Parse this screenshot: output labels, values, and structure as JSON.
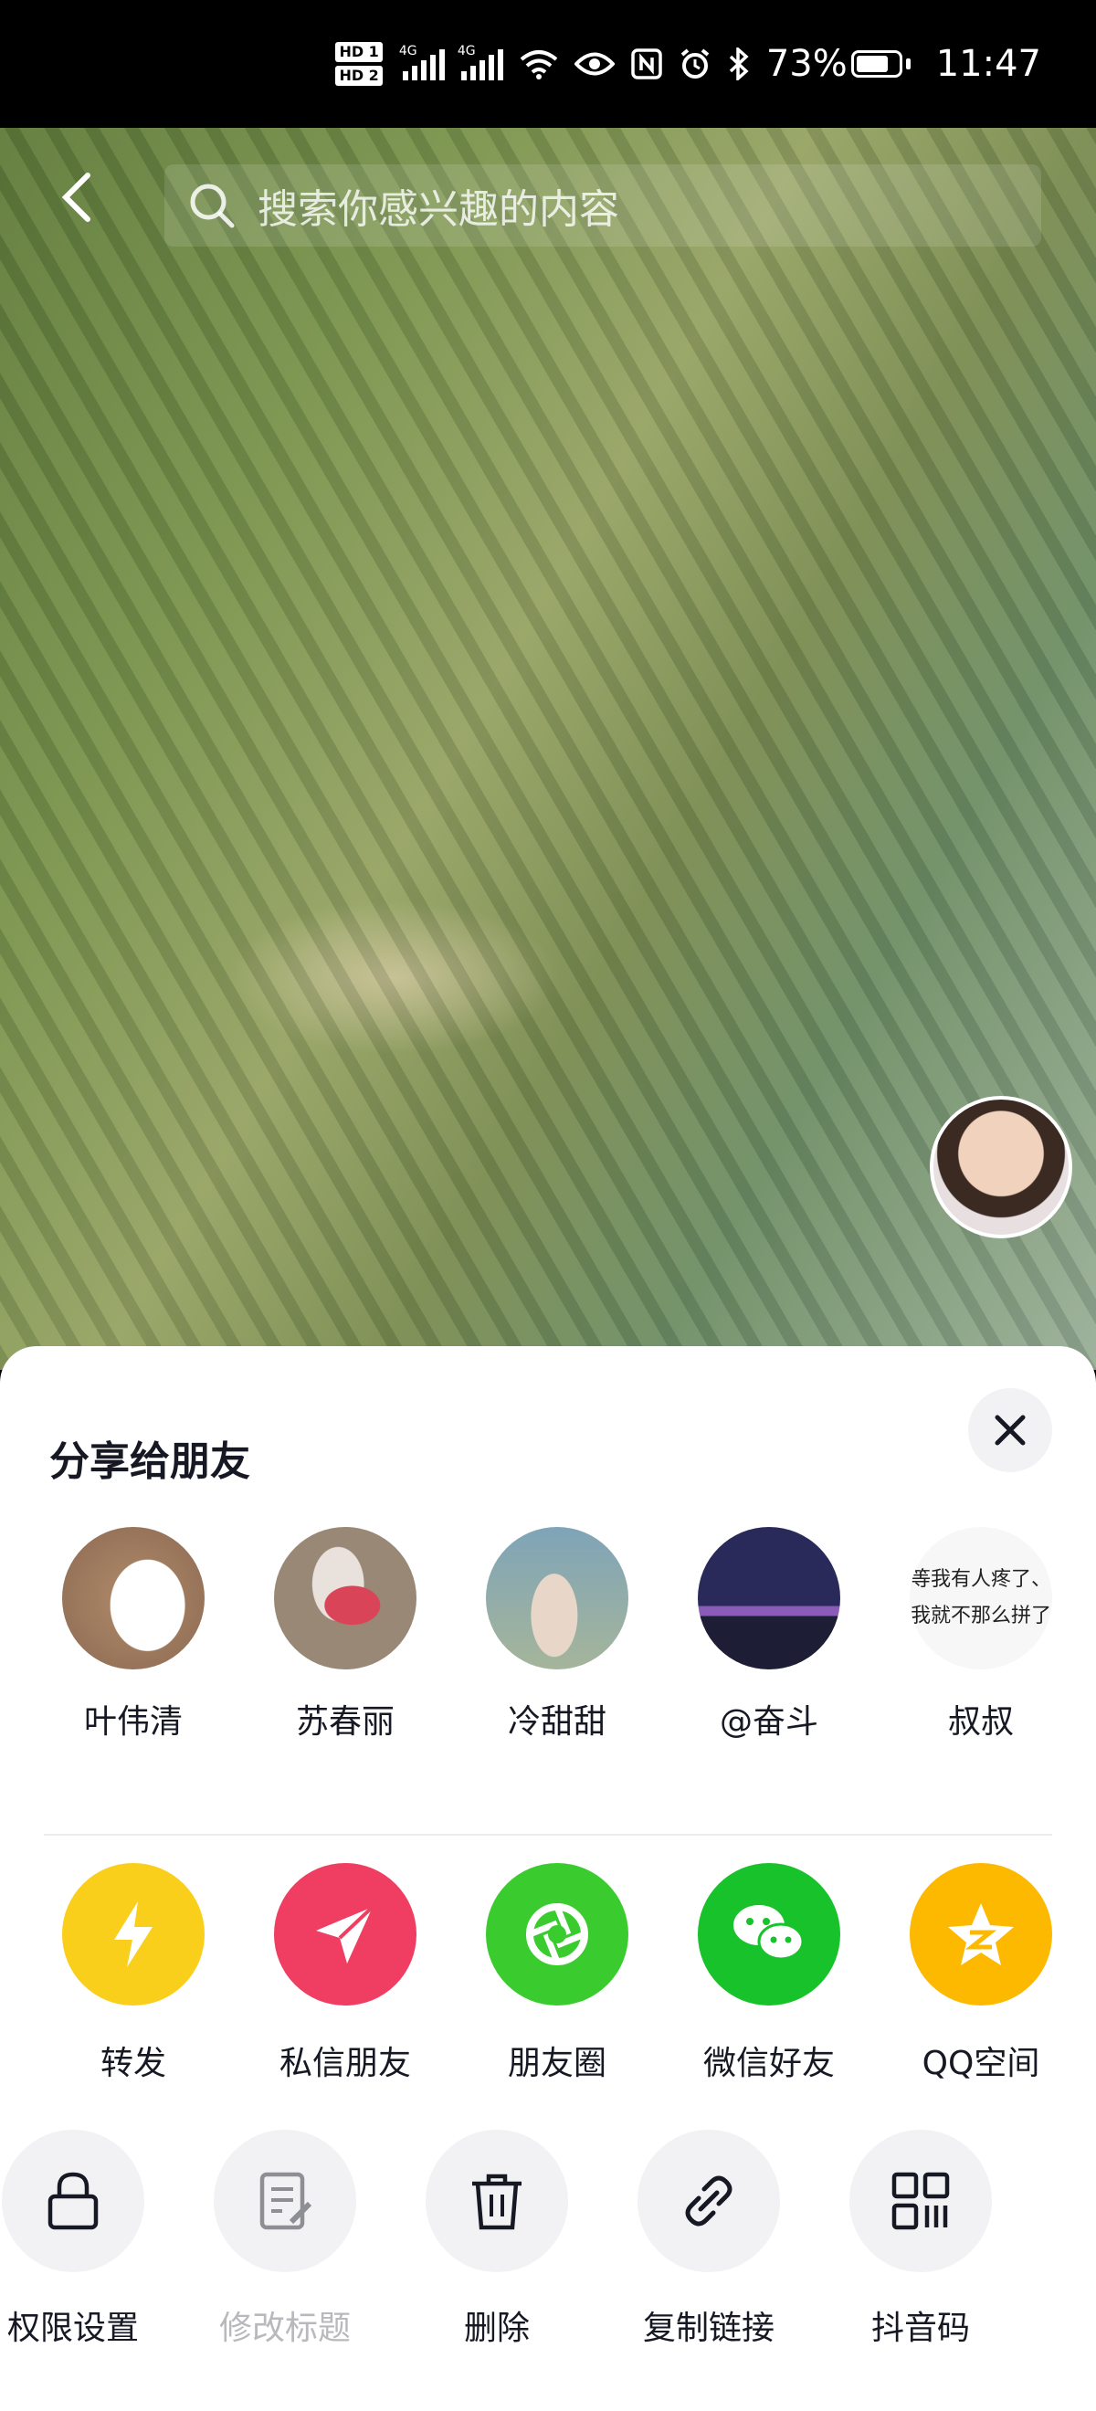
{
  "status_bar": {
    "hd1": "HD 1",
    "hd2": "HD 2",
    "net1": "4G",
    "net2": "4G",
    "battery": "73%",
    "time": "11:47"
  },
  "search": {
    "placeholder": "搜索你感兴趣的内容"
  },
  "share": {
    "title": "分享给朋友",
    "friends": [
      {
        "name": "叶伟清"
      },
      {
        "name": "苏春丽"
      },
      {
        "name": "冷甜甜"
      },
      {
        "name": "@奋斗"
      },
      {
        "name": "叔叔",
        "avatar_text_line1": "等我有人疼了、",
        "avatar_text_line2": "我就不那么拼了"
      }
    ],
    "apps": [
      {
        "label": "转发",
        "color": "#F9CF1B",
        "icon": "lightning-icon"
      },
      {
        "label": "私信朋友",
        "color": "#F03D62",
        "icon": "paper-plane-icon"
      },
      {
        "label": "朋友圈",
        "color": "#3ACC2E",
        "icon": "aperture-icon"
      },
      {
        "label": "微信好友",
        "color": "#17C22A",
        "icon": "wechat-icon"
      },
      {
        "label": "QQ空间",
        "color": "#FDB800",
        "icon": "qzone-star-icon"
      }
    ],
    "tools": [
      {
        "label": "权限设置",
        "icon": "lock-icon"
      },
      {
        "label": "修改标题",
        "icon": "edit-document-icon"
      },
      {
        "label": "删除",
        "icon": "trash-icon"
      },
      {
        "label": "复制链接",
        "icon": "link-icon"
      },
      {
        "label": "抖音码",
        "icon": "qr-code-icon"
      }
    ]
  }
}
